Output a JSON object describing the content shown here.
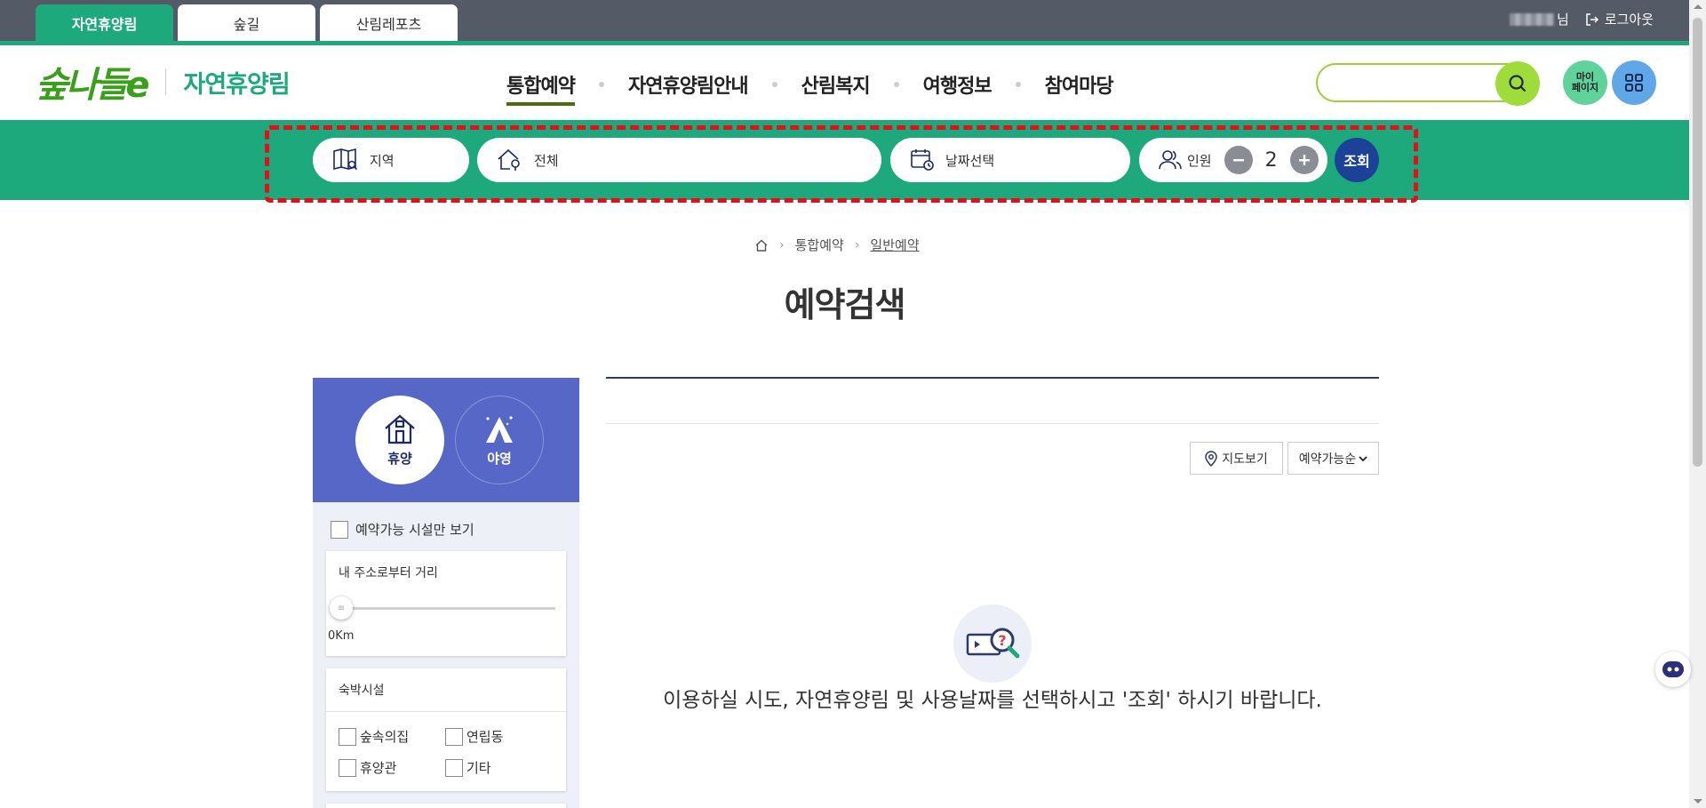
{
  "top_tabs": [
    {
      "label": "자연휴양림",
      "active": true
    },
    {
      "label": "숲길",
      "active": false
    },
    {
      "label": "산림레포츠",
      "active": false
    }
  ],
  "user": {
    "suffix": "님",
    "logout_label": "로그아웃"
  },
  "logo": {
    "mark": "숲나들e",
    "site_name": "자연휴양림"
  },
  "nav": [
    "통합예약",
    "자연휴양림안내",
    "산림복지",
    "여행정보",
    "참여마당"
  ],
  "header": {
    "search_placeholder": "",
    "mypage_label": "마이\n페이지"
  },
  "search_bar": {
    "region_label": "지역",
    "forest_label": "전체",
    "date_label": "날짜선택",
    "people_label": "인원",
    "people_count": "2",
    "submit_label": "조회"
  },
  "breadcrumb": {
    "items": [
      "통합예약",
      "일반예약"
    ]
  },
  "page_title": "예약검색",
  "side": {
    "categories": [
      {
        "label": "휴양"
      },
      {
        "label": "야영"
      }
    ],
    "available_only_label": "예약가능 시설만 보기",
    "distance": {
      "title": "내 주소로부터 거리",
      "value": "0Km"
    },
    "lodging": {
      "title": "숙박시설",
      "options": [
        "숲속의집",
        "연립동",
        "휴양관",
        "기타"
      ]
    }
  },
  "results": {
    "map_view_label": "지도보기",
    "sort_label": "예약가능순",
    "empty_message": "이용하실 시도, 자연휴양림 및 사용날짜를 선택하시고 '조회' 하시기 바랍니다."
  },
  "colors": {
    "brand_green": "#1ea97c",
    "topbar": "#555a67",
    "side_blue": "#5767c8",
    "submit_blue": "#1b4296",
    "highlight_red": "#e40f1a"
  }
}
